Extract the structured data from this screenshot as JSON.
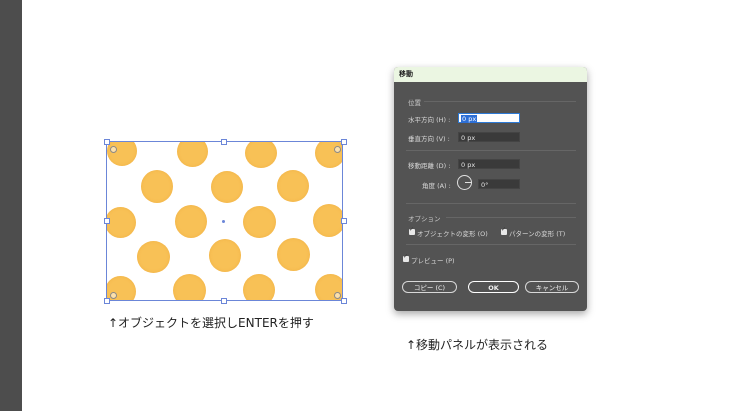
{
  "caption_left": "↑オブジェクトを選択しENTERを押す",
  "caption_right": "↑移動パネルが表示される",
  "dialog": {
    "title": "移動",
    "position_section": "位置",
    "horizontal_label": "水平方向 (H) :",
    "horizontal_value": "0 px",
    "vertical_label": "垂直方向 (V) :",
    "vertical_value": "0 px",
    "distance_label": "移動距離 (D) :",
    "distance_value": "0 px",
    "angle_label": "角度 (A) :",
    "angle_value": "0°",
    "options_section": "オプション",
    "transform_objects": "オブジェクトの変形 (O)",
    "transform_patterns": "パターンの変形 (T)",
    "preview": "プレビュー (P)",
    "copy_button": "コピー (C)",
    "ok_button": "OK",
    "cancel_button": "キャンセル"
  },
  "colors": {
    "dot": "#f8c156",
    "selection": "#6b86d8",
    "dialog_bg": "#535353",
    "title_bg": "#ebf6e2"
  }
}
